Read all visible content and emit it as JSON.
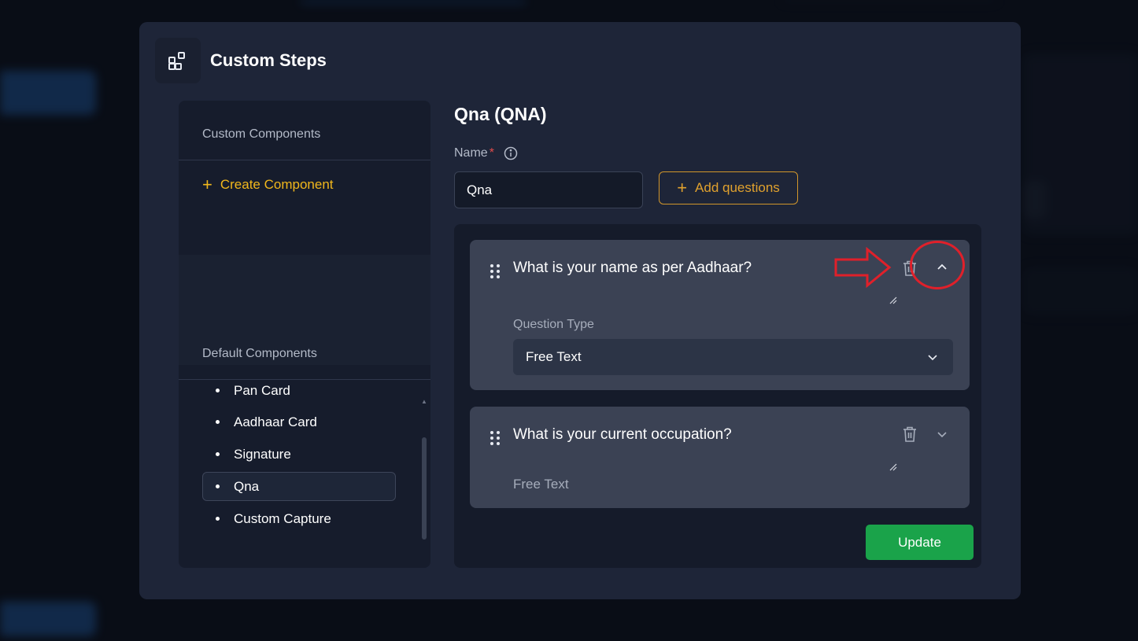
{
  "modal": {
    "title": "Custom Steps",
    "icon": "blocks-icon"
  },
  "sidebar": {
    "custom_heading": "Custom Components",
    "create_label": "Create Component",
    "default_heading": "Default Components",
    "items": [
      {
        "label": "Pan Card"
      },
      {
        "label": "Aadhaar Card"
      },
      {
        "label": "Signature"
      },
      {
        "label": "Qna",
        "active": true
      },
      {
        "label": "Custom Capture"
      }
    ]
  },
  "main": {
    "title": "Qna (QNA)",
    "name_label": "Name",
    "required_mark": "*",
    "name_value": "Qna",
    "add_questions_label": "Add questions",
    "update_label": "Update"
  },
  "questions": [
    {
      "text": "What is your name as per Aadhaar?",
      "expanded": true,
      "type_label": "Question Type",
      "type_value": "Free Text"
    },
    {
      "text": "What is your current occupation?",
      "expanded": false,
      "type_value": "Free Text"
    }
  ],
  "colors": {
    "accent_yellow": "#f1b71c",
    "accent_orange": "#e0a12e",
    "update_green": "#1aa34a",
    "annotation_red": "#e0202a"
  }
}
